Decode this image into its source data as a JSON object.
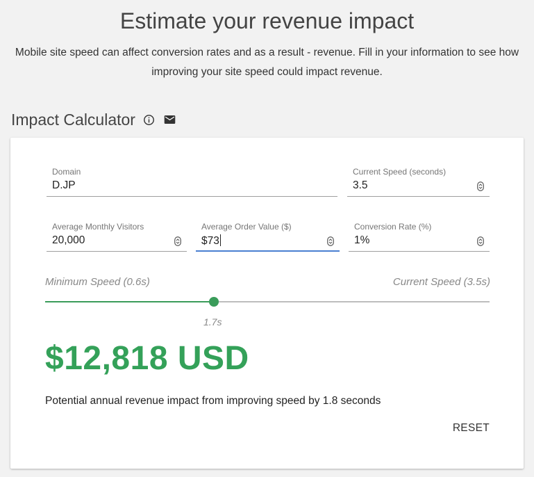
{
  "header": {
    "title": "Estimate your revenue impact",
    "subtitle": "Mobile site speed can affect conversion rates and as a result - revenue. Fill in your information to see how improving your site speed could impact revenue."
  },
  "calculator": {
    "title": "Impact Calculator",
    "info_icon": "info-icon",
    "email_icon": "email-icon"
  },
  "fields": {
    "domain": {
      "label": "Domain",
      "value": "D.JP"
    },
    "current_speed": {
      "label": "Current Speed (seconds)",
      "value": "3.5"
    },
    "monthly_visitors": {
      "label": "Average Monthly Visitors",
      "value": "20,000"
    },
    "order_value": {
      "label": "Average Order Value ($)",
      "value": "$73"
    },
    "conversion_rate": {
      "label": "Conversion Rate (%)",
      "value": "1%"
    }
  },
  "slider": {
    "min_label": "Minimum Speed (0.6s)",
    "max_label": "Current Speed (3.5s)",
    "value_label": "1.7s",
    "position_fraction": 0.38
  },
  "result": {
    "value": "$12,818 USD",
    "description": "Potential annual revenue impact from improving speed by 1.8 seconds"
  },
  "actions": {
    "reset_label": "RESET"
  },
  "colors": {
    "accent_green": "#34a159",
    "focus_blue": "#4a7fd1",
    "background": "#f2f2f2"
  }
}
